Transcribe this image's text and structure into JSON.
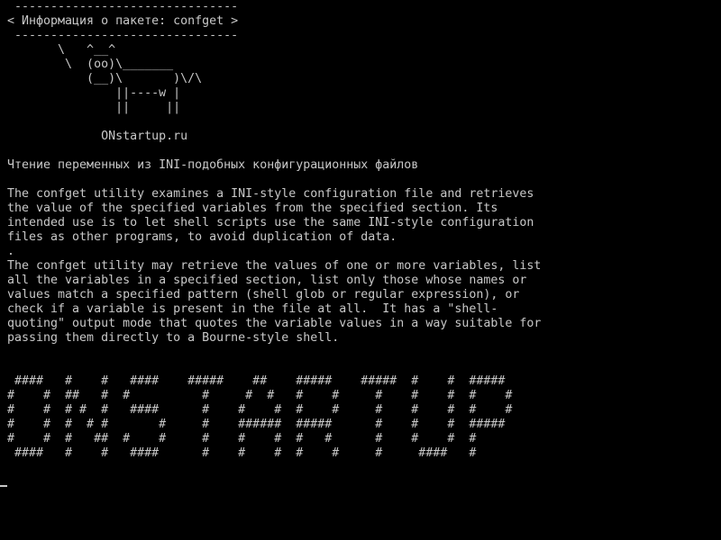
{
  "terminal": {
    "lines": [
      " -------------------------------",
      "< Информация о пакете: confget >",
      " -------------------------------",
      "       \\   ^__^",
      "        \\  (oo)\\_______",
      "           (__)\\       )\\/\\",
      "               ||----w |",
      "               ||     ||",
      "",
      "             ONstartup.ru",
      "",
      "Чтение переменных из INI-подобных конфигурационных файлов",
      "",
      "The confget utility examines a INI-style configuration file and retrieves",
      "the value of the specified variables from the specified section. Its",
      "intended use is to let shell scripts use the same INI-style configuration",
      "files as other programs, to avoid duplication of data.",
      ".",
      "The confget utility may retrieve the values of one or more variables, list",
      "all the variables in a specified section, list only those whose names or",
      "values match a specified pattern (shell glob or regular expression), or",
      "check if a variable is present in the file at all.  It has a \"shell-",
      "quoting\" output mode that quotes the variable values in a way suitable for",
      "passing them directly to a Bourne-style shell.",
      "",
      "",
      " ####   #    #   ####    #####    ##    #####    #####  #    #  #####",
      "#    #  ##   #  #          #     #  #   #    #     #    #    #  #    #",
      "#    #  # #  #   ####      #    #    #  #    #     #    #    #  #    #",
      "#    #  #  # #       #     #    ######  #####      #    #    #  #####",
      "#    #  #   ##  #    #     #    #    #  #   #      #    #    #  #",
      " ####   #    #   ####      #    #    #  #    #     #     ####   #",
      ""
    ]
  },
  "colors": {
    "background": "#000000",
    "foreground": "#c8c8c8"
  }
}
